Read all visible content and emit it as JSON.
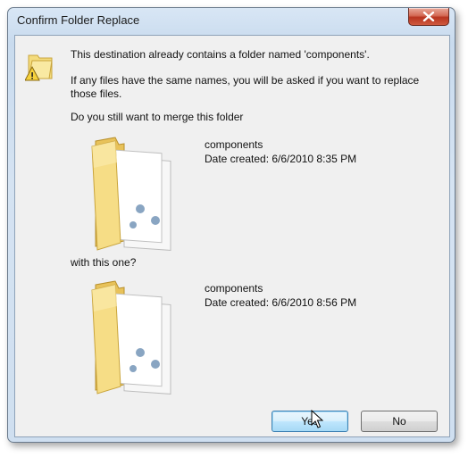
{
  "window": {
    "title": "Confirm Folder Replace",
    "close_icon": "close-icon"
  },
  "message": {
    "line1": "This destination already contains a folder named 'components'.",
    "line2": "If any files have the same names, you will be asked if you want to replace those files.",
    "line3": "Do you still want to merge this folder",
    "line4": "with this one?"
  },
  "source_folder": {
    "name": "components",
    "date_created": "Date created: 6/6/2010 8:35 PM"
  },
  "destination_folder": {
    "name": "components",
    "date_created": "Date created: 6/6/2010 8:56 PM"
  },
  "buttons": {
    "yes": "Yes",
    "no": "No"
  },
  "colors": {
    "folder": "#f2d776",
    "accent": "#3c7fb1",
    "close": "#c8452e"
  }
}
